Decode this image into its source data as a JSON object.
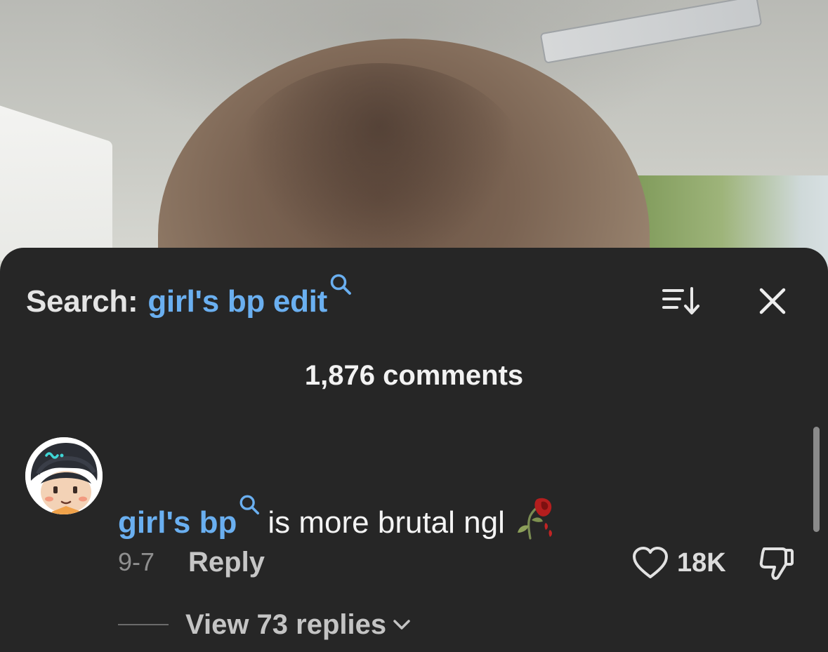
{
  "search": {
    "prefix": "Search:",
    "query": "girl's bp edit"
  },
  "header": {
    "sort_icon": "sort-list-icon",
    "close_icon": "close-icon"
  },
  "comments": {
    "count_label": "1,876 comments",
    "items": [
      {
        "avatar": "cartoon-avatar",
        "mention": "girl's bp",
        "text": "is more brutal ngl",
        "emoji": "wilted-rose-emoji",
        "date": "9-7",
        "reply_label": "Reply",
        "like_count": "18K",
        "view_replies_label": "View 73 replies"
      }
    ]
  },
  "colors": {
    "sheet_bg": "#262626",
    "link_blue": "#6aaff0",
    "text_primary": "#f4f4f4",
    "text_muted": "#8f8f8f"
  }
}
